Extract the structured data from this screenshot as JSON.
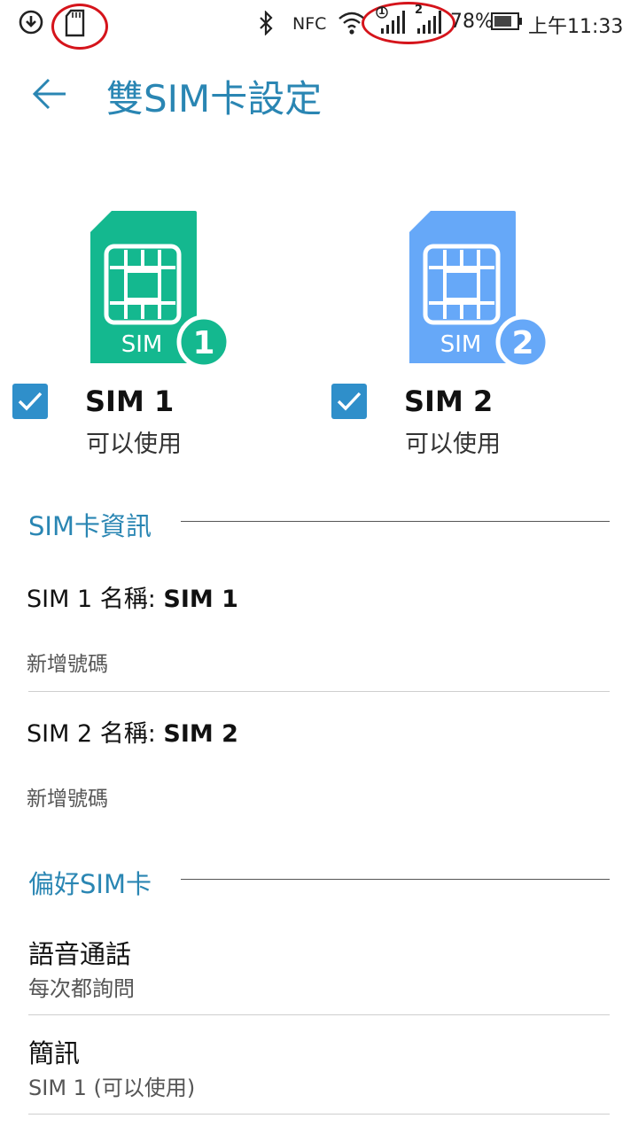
{
  "status_bar": {
    "battery_percent": "78%",
    "time": "上午11:33",
    "nfc_label": "NFC",
    "sim1_indicator": "1",
    "sim2_indicator": "2",
    "battery_level": 0.78
  },
  "header": {
    "title": "雙SIM卡設定"
  },
  "sims": [
    {
      "card_label": "SIM",
      "number": "1",
      "name": "SIM 1",
      "status": "可以使用",
      "checked": true,
      "color": "#14b88f"
    },
    {
      "card_label": "SIM",
      "number": "2",
      "name": "SIM 2",
      "status": "可以使用",
      "checked": true,
      "color": "#66a8f8"
    }
  ],
  "sim_info": {
    "header": "SIM卡資訊",
    "items": [
      {
        "label": "SIM 1 名稱: ",
        "value": "SIM 1",
        "action": "新增號碼"
      },
      {
        "label": "SIM 2 名稱: ",
        "value": "SIM 2",
        "action": "新增號碼"
      }
    ]
  },
  "preferred_sim": {
    "header": "偏好SIM卡",
    "items": [
      {
        "title": "語音通話",
        "value": "每次都詢問"
      },
      {
        "title": "簡訊",
        "value": "SIM 1 (可以使用)"
      }
    ]
  },
  "colors": {
    "accent": "#2a86b3",
    "checkbox": "#2f8fca",
    "annotation_red": "#d5141b"
  }
}
